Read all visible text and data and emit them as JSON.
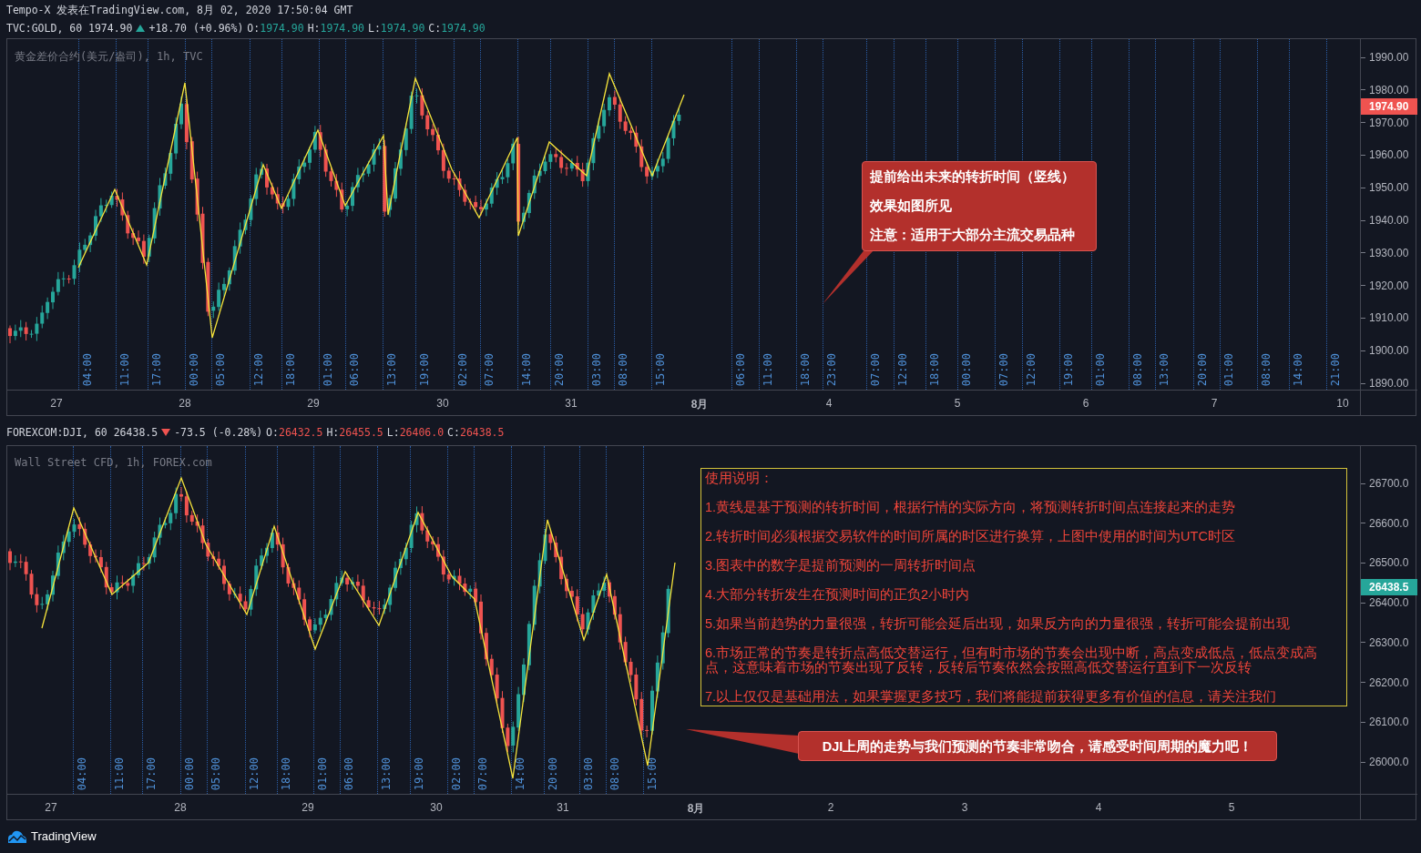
{
  "header": {
    "byline": "Tempo-X 发表在TradingView.com, 8月 02, 2020 17:50:04 GMT"
  },
  "panes": [
    {
      "legend": {
        "symbol": "TVC:GOLD, 60 1974.90",
        "rising": true,
        "change": "+18.70 (+0.96%)",
        "ohlc": [
          {
            "key": "O:",
            "value": "1974.90"
          },
          {
            "key": "H:",
            "value": "1974.90"
          },
          {
            "key": "L:",
            "value": "1974.90"
          },
          {
            "key": "C:",
            "value": "1974.90"
          }
        ]
      },
      "title": "黄金差价合约(美元/盎司), 1h, TVC",
      "price_ticks": [
        "1990.00",
        "1980.00",
        "1970.00",
        "1960.00",
        "1950.00",
        "1940.00",
        "1930.00",
        "1920.00",
        "1910.00",
        "1900.00",
        "1890.00"
      ],
      "last_price": "1974.90",
      "time_markers": [
        "04:00",
        "11:00",
        "17:00",
        "00:00",
        "05:00",
        "12:00",
        "18:00",
        "01:00",
        "06:00",
        "13:00",
        "19:00",
        "02:00",
        "07:00",
        "14:00",
        "20:00",
        "03:00",
        "08:00",
        "15:00",
        "06:00",
        "11:00",
        "18:00",
        "23:00",
        "07:00",
        "12:00",
        "18:00",
        "00:00",
        "07:00",
        "12:00",
        "19:00",
        "01:00",
        "08:00",
        "13:00",
        "20:00",
        "01:00",
        "08:00",
        "14:00",
        "21:00"
      ],
      "dates": [
        {
          "label": "27",
          "bold": false
        },
        {
          "label": "28",
          "bold": false
        },
        {
          "label": "29",
          "bold": false
        },
        {
          "label": "30",
          "bold": false
        },
        {
          "label": "31",
          "bold": false
        },
        {
          "label": "8月",
          "bold": true
        },
        {
          "label": "4",
          "bold": false
        },
        {
          "label": "5",
          "bold": false
        },
        {
          "label": "6",
          "bold": false
        },
        {
          "label": "7",
          "bold": false
        },
        {
          "label": "10",
          "bold": false
        }
      ],
      "annotations": [
        {
          "kind": "callout",
          "lines": [
            "提前给出未来的转折时间（竖线）",
            "效果如图所见",
            "注意：适用于大部分主流交易品种"
          ]
        }
      ]
    },
    {
      "legend": {
        "symbol": "FOREXCOM:DJI, 60 26438.5",
        "rising": false,
        "change": "-73.5 (-0.28%)",
        "ohlc": [
          {
            "key": "O:",
            "value": "26432.5"
          },
          {
            "key": "H:",
            "value": "26455.5"
          },
          {
            "key": "L:",
            "value": "26406.0"
          },
          {
            "key": "C:",
            "value": "26438.5"
          }
        ]
      },
      "title": "Wall Street CFD, 1h, FOREX.com",
      "price_ticks": [
        "26700.0",
        "26600.0",
        "26500.0",
        "26400.0",
        "26300.0",
        "26200.0",
        "26100.0",
        "26000.0"
      ],
      "last_price": "26438.5",
      "time_markers": [
        "04:00",
        "11:00",
        "17:00",
        "00:00",
        "05:00",
        "12:00",
        "18:00",
        "01:00",
        "06:00",
        "13:00",
        "19:00",
        "02:00",
        "07:00",
        "14:00",
        "20:00",
        "03:00",
        "08:00",
        "15:00"
      ],
      "dates": [
        {
          "label": "27",
          "bold": false
        },
        {
          "label": "28",
          "bold": false
        },
        {
          "label": "29",
          "bold": false
        },
        {
          "label": "30",
          "bold": false
        },
        {
          "label": "31",
          "bold": false
        },
        {
          "label": "8月",
          "bold": true
        },
        {
          "label": "2",
          "bold": false
        },
        {
          "label": "3",
          "bold": false
        },
        {
          "label": "4",
          "bold": false
        },
        {
          "label": "5",
          "bold": false
        }
      ],
      "annotations": [
        {
          "kind": "notes",
          "title": "使用说明：",
          "items": [
            "1.黄线是基于预测的转折时间，根据行情的实际方向，将预测转折时间点连接起来的走势",
            "2.转折时间必须根据交易软件的时间所属的时区进行换算，上图中使用的时间为UTC时区",
            "3.图表中的数字是提前预测的一周转折时间点",
            "4.大部分转折发生在预测时间的正负2小时内",
            "5.如果当前趋势的力量很强，转折可能会延后出现，如果反方向的力量很强，转折可能会提前出现",
            "6.市场正常的节奏是转折点高低交替运行，但有时市场的节奏会出现中断，高点变成低点，低点变成高点，这意味着市场的节奏出现了反转，反转后节奏依然会按照高低交替运行直到下一次反转",
            "7.以上仅仅是基础用法，如果掌握更多技巧，我们将能提前获得更多有价值的信息，请关注我们"
          ]
        },
        {
          "kind": "callout",
          "lines": [
            "DJI上周的走势与我们预测的节奏非常吻合，请感受时间周期的魔力吧！"
          ]
        }
      ]
    }
  ],
  "footer": {
    "brand": "TradingView"
  }
}
